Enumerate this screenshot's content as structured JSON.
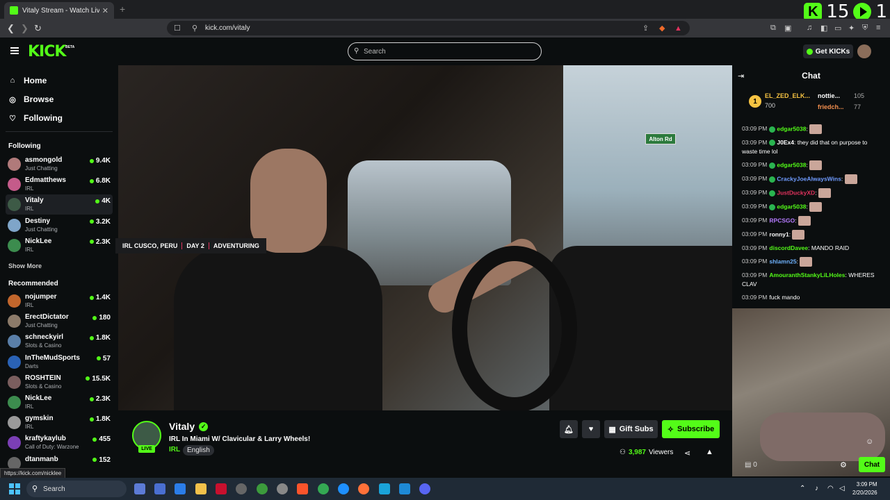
{
  "browser": {
    "tab_title": "Vitaly Stream - Watch Live on",
    "tab_close": "✕",
    "new_tab": "+",
    "url": "kick.com/vitaly"
  },
  "overlay": {
    "left_num": "15",
    "right_num": "1"
  },
  "header": {
    "logo": "KICK",
    "beta": "BETA",
    "search_placeholder": "Search",
    "get_kicks": "Get KICKs"
  },
  "sidebar": {
    "nav": [
      {
        "label": "Home",
        "icon": "home-icon"
      },
      {
        "label": "Browse",
        "icon": "compass-icon"
      },
      {
        "label": "Following",
        "icon": "heart-icon"
      }
    ],
    "following_title": "Following",
    "following": [
      {
        "name": "asmongold",
        "category": "Just Chatting",
        "viewers": "9.4K",
        "color": "#b07a7a"
      },
      {
        "name": "Edmatthews",
        "category": "IRL",
        "viewers": "6.8K",
        "color": "#c45b8a"
      },
      {
        "name": "Vitaly",
        "category": "IRL",
        "viewers": "4K",
        "color": "#3d5a46"
      },
      {
        "name": "Destiny",
        "category": "Just Chatting",
        "viewers": "3.2K",
        "color": "#7fa5c9"
      },
      {
        "name": "NickLee",
        "category": "IRL",
        "viewers": "2.3K",
        "color": "#3c8c4e"
      }
    ],
    "show_more": "Show More",
    "recommended_title": "Recommended",
    "recommended": [
      {
        "name": "nojumper",
        "category": "IRL",
        "viewers": "1.4K",
        "color": "#c2662c"
      },
      {
        "name": "ErectDictator",
        "category": "Just Chatting",
        "viewers": "180",
        "color": "#8c7b6a"
      },
      {
        "name": "schneckyirl",
        "category": "Slots & Casino",
        "viewers": "1.8K",
        "color": "#5a7fa8"
      },
      {
        "name": "InTheMudSports",
        "category": "Darts",
        "viewers": "57",
        "color": "#2a62b5"
      },
      {
        "name": "ROSHTEIN",
        "category": "Slots & Casino",
        "viewers": "15.5K",
        "color": "#7a5e5e"
      },
      {
        "name": "NickLee",
        "category": "IRL",
        "viewers": "2.3K",
        "color": "#3c8c4e"
      },
      {
        "name": "gymskin",
        "category": "IRL",
        "viewers": "1.8K",
        "color": "#9a9a9a"
      },
      {
        "name": "kraftykaylub",
        "category": "Call of Duty: Warzone",
        "viewers": "455",
        "color": "#7b3fb5"
      },
      {
        "name": "dtanmanb",
        "category": "",
        "viewers": "152",
        "color": "#666"
      }
    ]
  },
  "video": {
    "street_sign": "Alton Rd",
    "tags": [
      "IRL CUSCO, PERU",
      "DAY 2",
      "ADVENTURING"
    ]
  },
  "stream": {
    "live": "LIVE",
    "name": "Vitaly",
    "title": "IRL In Miami W/ Clavicular & Larry Wheels!",
    "category": "IRL",
    "language": "English",
    "gift_subs": "Gift Subs",
    "subscribe": "Subscribe",
    "viewers": "3,987",
    "viewers_label": "Viewers"
  },
  "chat": {
    "title": "Chat",
    "leaderboard": [
      {
        "rank": "1",
        "name": "EL_ZED_ELK...",
        "value": "700"
      },
      {
        "name": "nottie...",
        "value": "105"
      },
      {
        "name": "friedch...",
        "value": "77"
      }
    ],
    "messages": [
      {
        "time": "03:09 PM",
        "user": "edgar5038",
        "color": "#53fc18",
        "text": "",
        "emote": true,
        "badge": true
      },
      {
        "time": "03:09 PM",
        "user": "J0Ex4",
        "color": "#ffffff",
        "text": "they did that on purpose to waste time lol",
        "emote": false,
        "badge": true
      },
      {
        "time": "03:09 PM",
        "user": "edgar5038",
        "color": "#53fc18",
        "text": "",
        "emote": true,
        "badge": true
      },
      {
        "time": "03:09 PM",
        "user": "CrackyJoeAlwaysWins",
        "color": "#6f9bff",
        "text": "",
        "emote": true,
        "badge": true
      },
      {
        "time": "03:09 PM",
        "user": "JustDuckyXD",
        "color": "#e0325d",
        "text": "",
        "emote": true,
        "badge": true
      },
      {
        "time": "03:09 PM",
        "user": "edgar5038",
        "color": "#53fc18",
        "text": "",
        "emote": true,
        "badge": true
      },
      {
        "time": "03:09 PM",
        "user": "RPCSGO",
        "color": "#b57bff",
        "text": "",
        "emote": true,
        "badge": false
      },
      {
        "time": "03:09 PM",
        "user": "ronny1",
        "color": "#ffffff",
        "text": "",
        "emote": true,
        "badge": false
      },
      {
        "time": "03:09 PM",
        "user": "discordDavee",
        "color": "#53fc18",
        "text": "MANDO RAID",
        "emote": false,
        "badge": false
      },
      {
        "time": "03:09 PM",
        "user": "shlamn25",
        "color": "#6fb3ff",
        "text": "",
        "emote": true,
        "badge": false
      },
      {
        "time": "03:09 PM",
        "user": "AmouranthStankyLiLHoles",
        "color": "#53fc18",
        "text": "WHERES CLAV",
        "emote": false,
        "badge": false
      },
      {
        "time": "03:09 PM",
        "user": "",
        "color": "#aaaaaa",
        "text": "fuck mando",
        "emote": false,
        "badge": false
      }
    ],
    "points": "0",
    "send": "Chat"
  },
  "status_url": "https://kick.com/nicklee",
  "taskbar": {
    "search": "Search",
    "time": "3:09 PM",
    "date": "2/20/2026"
  }
}
